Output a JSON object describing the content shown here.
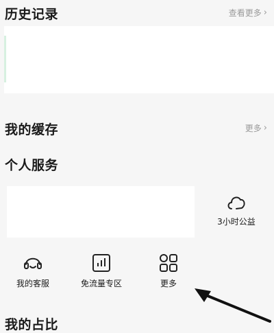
{
  "history": {
    "title": "历史记录",
    "more": "查看更多"
  },
  "cache": {
    "title": "我的缓存",
    "more": "更多"
  },
  "services": {
    "title": "个人服务",
    "items": [
      {
        "label": "3小时公益",
        "icon": "cloud-heart-icon"
      },
      {
        "label": "我的客服",
        "icon": "headset-icon"
      },
      {
        "label": "免流量专区",
        "icon": "bar-chart-icon"
      },
      {
        "label": "更多",
        "icon": "grid-icon"
      }
    ]
  },
  "bottom": {
    "title": "我的占比"
  },
  "colors": {
    "background": "#f6f6f6",
    "card": "#ffffff",
    "muted": "#9a9a9a",
    "text": "#1a1a1a"
  }
}
